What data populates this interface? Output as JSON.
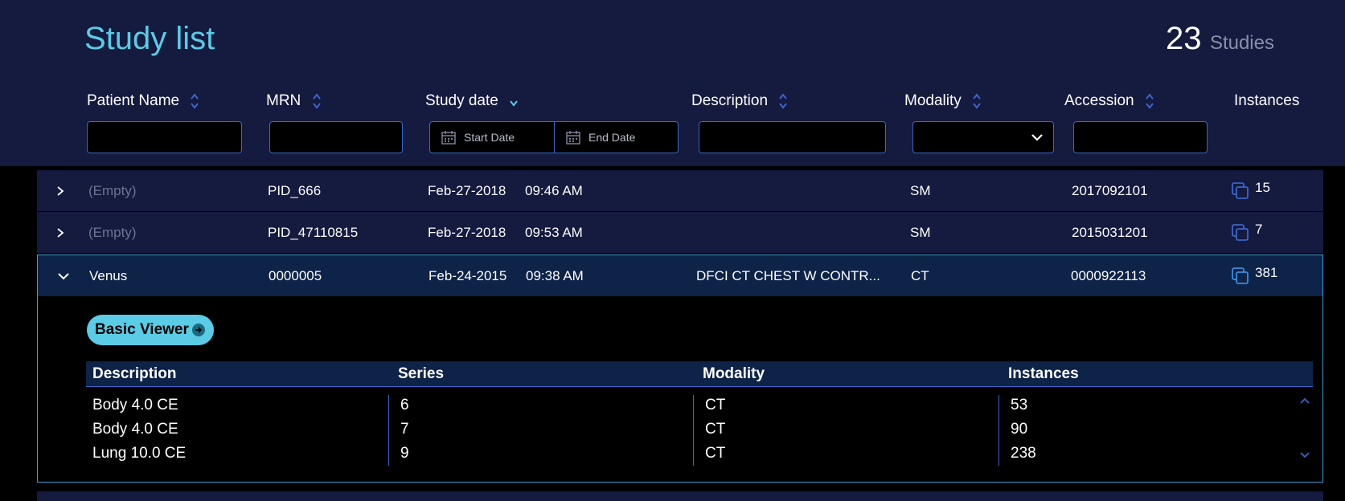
{
  "header": {
    "title": "Study list",
    "count": "23",
    "count_label": "Studies"
  },
  "columns": {
    "patient_name": "Patient Name",
    "mrn": "MRN",
    "study_date": "Study date",
    "description": "Description",
    "modality": "Modality",
    "accession": "Accession",
    "instances": "Instances"
  },
  "filters": {
    "start_date_placeholder": "Start Date",
    "end_date_placeholder": "End Date",
    "modality_selected": ""
  },
  "studies": [
    {
      "patient": "(Empty)",
      "mrn": "PID_666",
      "date": "Feb-27-2018",
      "time": "09:46 AM",
      "description": "",
      "modality": "SM",
      "accession": "2017092101",
      "instances": "15"
    },
    {
      "patient": "(Empty)",
      "mrn": "PID_47110815",
      "date": "Feb-27-2018",
      "time": "09:53 AM",
      "description": "",
      "modality": "SM",
      "accession": "2015031201",
      "instances": "7"
    },
    {
      "patient": "Venus",
      "mrn": "0000005",
      "date": "Feb-24-2015",
      "time": "09:38 AM",
      "description": "DFCI CT CHEST W CONTR...",
      "modality": "CT",
      "accession": "0000922113",
      "instances": "381"
    }
  ],
  "expanded": {
    "viewer_button": "Basic Viewer",
    "series_columns": {
      "description": "Description",
      "series": "Series",
      "modality": "Modality",
      "instances": "Instances"
    },
    "series": [
      {
        "description": "Body 4.0 CE",
        "series": "6",
        "modality": "CT",
        "instances": "53"
      },
      {
        "description": "Body 4.0 CE",
        "series": "7",
        "modality": "CT",
        "instances": "90"
      },
      {
        "description": "Lung 10.0 CE",
        "series": "9",
        "modality": "CT",
        "instances": "238"
      }
    ]
  },
  "colors": {
    "header_bg": "#151a3f",
    "accent": "#5acce6",
    "border_blue": "#3a66c9",
    "expanded_row_bg": "#0d2348"
  }
}
